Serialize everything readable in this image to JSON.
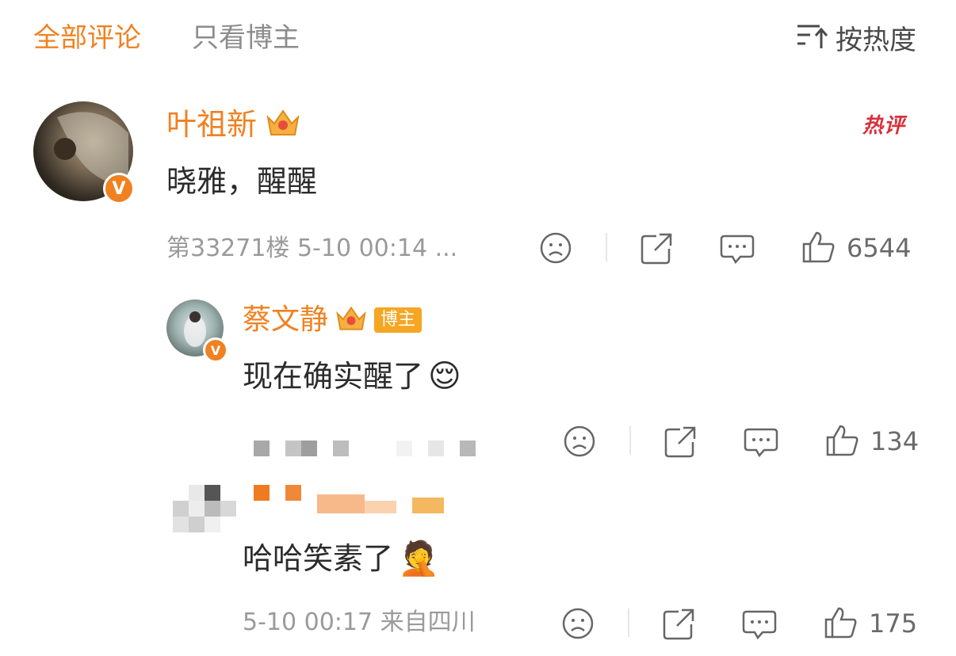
{
  "tabs": {
    "all_label": "全部评论",
    "host_only_label": "只看博主"
  },
  "sort": {
    "label": "按热度",
    "icon": "sort-icon"
  },
  "colors": {
    "accent": "#f08121",
    "hot_badge": "#d9303a",
    "text": "#2b2b2b",
    "muted": "#9a9a9a"
  },
  "comment": {
    "username": "叶祖新",
    "hot_label": "热评",
    "text": "晓雅，醒醒",
    "meta": "第33271楼  5-10 00:14  ...",
    "likes": "6544"
  },
  "reply1": {
    "username": "蔡文静",
    "host_badge": "博主",
    "text": "现在确实醒了",
    "emoji": "😌",
    "likes": "134"
  },
  "reply2": {
    "text": "哈哈笑素了",
    "emoji": "🤦",
    "meta": "5-10 00:17  来自四川",
    "likes": "175"
  }
}
